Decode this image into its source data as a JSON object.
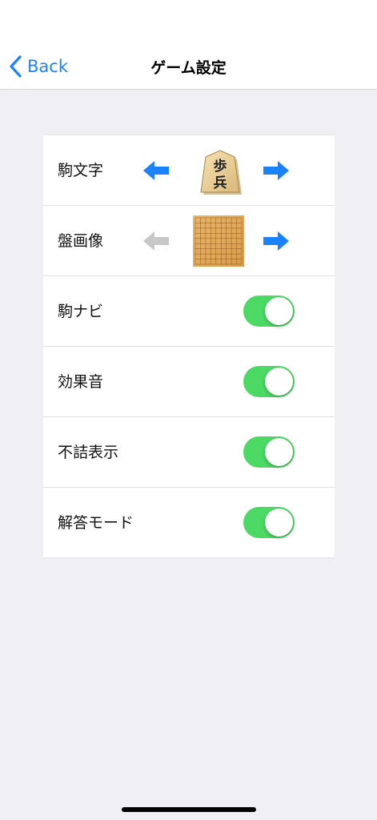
{
  "nav": {
    "back_label": "Back",
    "title": "ゲーム設定"
  },
  "settings": {
    "piece_style": {
      "label": "駒文字",
      "piece_glyph_top": "歩",
      "piece_glyph_bottom": "兵",
      "left_enabled": true,
      "right_enabled": true
    },
    "board_image": {
      "label": "盤画像",
      "left_enabled": false,
      "right_enabled": true
    },
    "piece_navi": {
      "label": "駒ナビ",
      "on": true
    },
    "sound_effects": {
      "label": "効果音",
      "on": true
    },
    "show_invalid": {
      "label": "不詰表示",
      "on": true
    },
    "answer_mode": {
      "label": "解答モード",
      "on": true
    }
  },
  "colors": {
    "accent": "#1a82fb",
    "toggle_on": "#4cd964",
    "arrow_disabled": "#c8c8c8",
    "background": "#efeff4"
  },
  "icons": [
    "chevron-left-icon",
    "arrow-left-icon",
    "arrow-right-icon",
    "shogi-piece-icon",
    "shogi-board-icon"
  ]
}
